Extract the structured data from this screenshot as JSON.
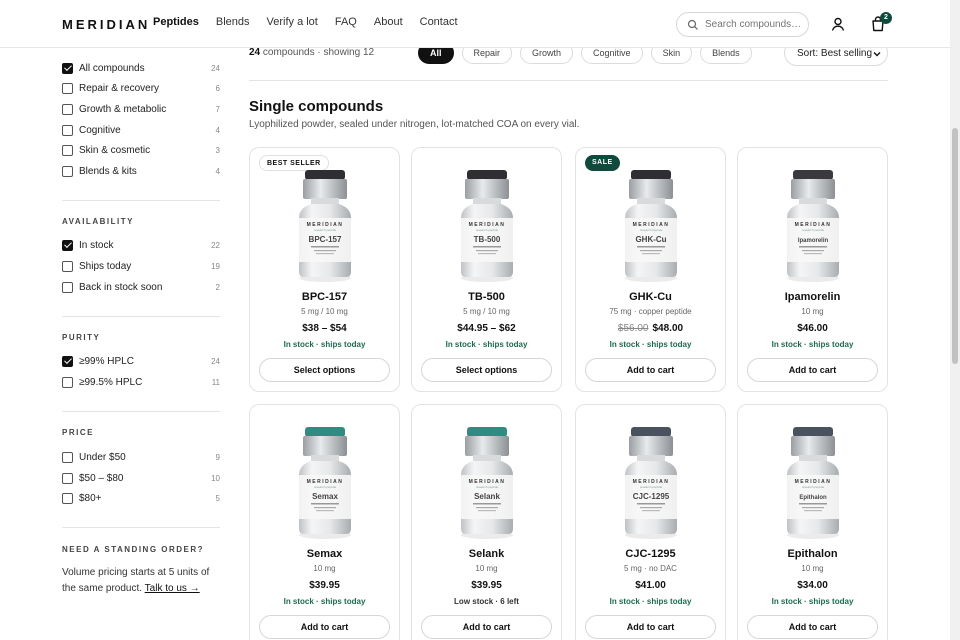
{
  "header": {
    "logo": "MERIDIAN",
    "nav": [
      "Peptides",
      "Blends",
      "Verify a lot",
      "FAQ",
      "About",
      "Contact"
    ],
    "search_placeholder": "Search compounds…",
    "cart_count": "2"
  },
  "sidebar": {
    "categories": [
      {
        "label": "All compounds",
        "count": "24",
        "checked": true
      },
      {
        "label": "Repair & recovery",
        "count": "6",
        "checked": false
      },
      {
        "label": "Growth & metabolic",
        "count": "7",
        "checked": false
      },
      {
        "label": "Cognitive",
        "count": "4",
        "checked": false
      },
      {
        "label": "Skin & cosmetic",
        "count": "3",
        "checked": false
      },
      {
        "label": "Blends & kits",
        "count": "4",
        "checked": false
      }
    ],
    "availability": {
      "title": "AVAILABILITY",
      "items": [
        {
          "label": "In stock",
          "count": "22",
          "checked": true
        },
        {
          "label": "Ships today",
          "count": "19",
          "checked": false
        },
        {
          "label": "Back in stock soon",
          "count": "2",
          "checked": false
        }
      ]
    },
    "purity": {
      "title": "PURITY",
      "items": [
        {
          "label": "≥99% HPLC",
          "count": "24",
          "checked": true
        },
        {
          "label": "≥99.5% HPLC",
          "count": "11",
          "checked": false
        }
      ]
    },
    "price": {
      "title": "PRICE",
      "items": [
        {
          "label": "Under $50",
          "count": "9",
          "checked": false
        },
        {
          "label": "$50 – $80",
          "count": "10",
          "checked": false
        },
        {
          "label": "$80+",
          "count": "5",
          "checked": false
        }
      ]
    },
    "standing": {
      "title": "NEED A STANDING ORDER?",
      "text": "Volume pricing starts at 5 units of the same product.",
      "link": "Talk to us →"
    }
  },
  "toolbar": {
    "count_bold": "24",
    "count_rest": "compounds · showing 12",
    "chips": [
      "All",
      "Repair",
      "Growth",
      "Cognitive",
      "Skin",
      "Blends"
    ],
    "sort": "Sort: Best selling"
  },
  "section": {
    "title": "Single compounds",
    "subtitle": "Lyophilized powder, sealed under nitrogen, lot-matched COA on every vial."
  },
  "products": [
    {
      "name": "BPC-157",
      "label": "BPC-157",
      "spec": "5 mg / 10 mg",
      "old_price": "",
      "price": "$38 – $54",
      "stock": "In stock · ships today",
      "stock_level": "ok",
      "button": "Select options",
      "badge": "BEST SELLER",
      "badge_type": "best",
      "cap_color": "#2f2f33"
    },
    {
      "name": "TB-500",
      "label": "TB-500",
      "spec": "5 mg / 10 mg",
      "old_price": "",
      "price": "$44.95 – $62",
      "stock": "In stock · ships today",
      "stock_level": "ok",
      "button": "Select options",
      "badge": "",
      "badge_type": "",
      "cap_color": "#2f2f33"
    },
    {
      "name": "GHK-Cu",
      "label": "GHK-Cu",
      "spec": "75 mg · copper peptide",
      "old_price": "$56.00",
      "price": "$48.00",
      "stock": "In stock · ships today",
      "stock_level": "ok",
      "button": "Add to cart",
      "badge": "SALE",
      "badge_type": "sale",
      "cap_color": "#2f2f33"
    },
    {
      "name": "Ipamorelin",
      "label": "Ipamorelin",
      "spec": "10 mg",
      "old_price": "",
      "price": "$46.00",
      "stock": "In stock · ships today",
      "stock_level": "ok",
      "button": "Add to cart",
      "badge": "",
      "badge_type": "",
      "cap_color": "#3a3a3e"
    },
    {
      "name": "Semax",
      "label": "Semax",
      "spec": "10 mg",
      "old_price": "",
      "price": "$39.95",
      "stock": "In stock · ships today",
      "stock_level": "ok",
      "button": "Add to cart",
      "badge": "",
      "badge_type": "",
      "cap_color": "#2e8c83"
    },
    {
      "name": "Selank",
      "label": "Selank",
      "spec": "10 mg",
      "old_price": "",
      "price": "$39.95",
      "stock": "Low stock · 6 left",
      "stock_level": "low",
      "button": "Add to cart",
      "badge": "",
      "badge_type": "",
      "cap_color": "#2e8c83"
    },
    {
      "name": "CJC-1295",
      "label": "CJC-1295",
      "spec": "5 mg · no DAC",
      "old_price": "",
      "price": "$41.00",
      "stock": "In stock · ships today",
      "stock_level": "ok",
      "button": "Add to cart",
      "badge": "",
      "badge_type": "",
      "cap_color": "#4a5260"
    },
    {
      "name": "Epithalon",
      "label": "Epithalon",
      "spec": "10 mg",
      "old_price": "",
      "price": "$34.00",
      "stock": "In stock · ships today",
      "stock_level": "ok",
      "button": "Add to cart",
      "badge": "",
      "badge_type": "",
      "cap_color": "#4a5260"
    }
  ]
}
